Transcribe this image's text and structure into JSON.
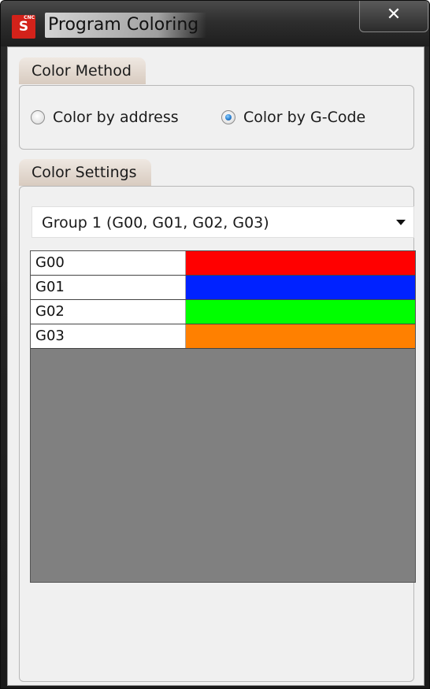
{
  "window": {
    "title": "Program Coloring",
    "app_icon_letter": "S",
    "app_icon_badge": "CNC",
    "close_glyph": "✕"
  },
  "color_method": {
    "tab_label": "Color Method",
    "options": [
      {
        "label": "Color by address",
        "checked": false
      },
      {
        "label": "Color by G-Code",
        "checked": true
      }
    ]
  },
  "color_settings": {
    "tab_label": "Color Settings",
    "group_select": {
      "value": "Group 1 (G00, G01, G02, G03)"
    },
    "rows": [
      {
        "code": "G00",
        "color": "#ff0000"
      },
      {
        "code": "G01",
        "color": "#0022ff"
      },
      {
        "code": "G02",
        "color": "#00ff00"
      },
      {
        "code": "G03",
        "color": "#ff8000"
      }
    ]
  }
}
